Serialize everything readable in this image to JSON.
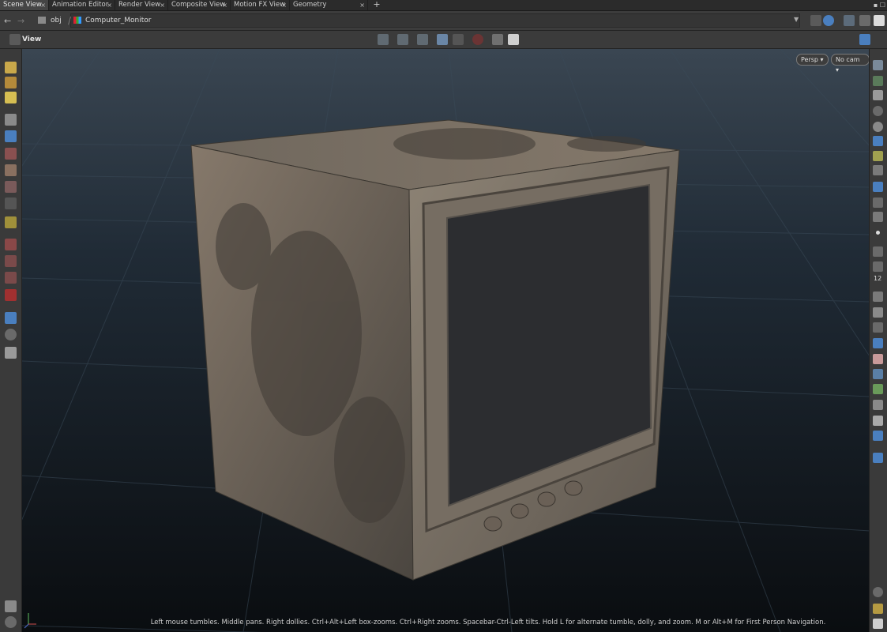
{
  "tabs": [
    {
      "label": "Scene View",
      "active": true
    },
    {
      "label": "Animation Editor",
      "active": false
    },
    {
      "label": "Render View",
      "active": false
    },
    {
      "label": "Composite View",
      "active": false
    },
    {
      "label": "Motion FX View",
      "active": false
    },
    {
      "label": "Geometry Spreadsheet",
      "active": false
    }
  ],
  "tab_close_glyph": "×",
  "add_tab_glyph": "+",
  "window_controls": "▪ ☐",
  "path": {
    "root": "obj",
    "node": "Computer_Monitor"
  },
  "viewer": {
    "label": "View"
  },
  "viewport": {
    "camera_mode": "Persp",
    "camera": "No cam"
  },
  "status_text": "Left mouse tumbles. Middle pans. Right dollies. Ctrl+Alt+Left box-zooms. Ctrl+Right zooms. Spacebar-Ctrl-Left tilts. Hold L for alternate tumble, dolly, and zoom.     M or Alt+M for First Person Navigation.",
  "right_toolbar_number": "12",
  "colors": {
    "tab_active": "#454545",
    "accent_blue": "#4a7fbf",
    "grid": "#2c3a47",
    "background": "#1e2a36",
    "model": "#7d7569",
    "screen": "#2c2d30"
  },
  "icons": {
    "left_toolbar": [
      "paint-icon",
      "pose-icon",
      "sculpt-icon",
      "select-icon",
      "lock-icon",
      "handle-icon",
      "view-icon",
      "camera-icon",
      "light-icon",
      "scale-icon",
      "rotate-icon",
      "magnet-icon",
      "snap-icon",
      "pivot-icon",
      "display-icon",
      "render-icon"
    ],
    "right_toolbar": [
      "display-options-icon",
      "wire-icon",
      "lock-icon",
      "xray-icon",
      "shade-icon",
      "light-icon",
      "bulb-icon",
      "camera-light-icon",
      "cam-icon",
      "pose-icon",
      "point-icon",
      "edge-icon",
      "brush-icon",
      "number-icon",
      "cut-icon",
      "paint-icon",
      "curve-icon",
      "knife-icon",
      "checker-icon",
      "plane-icon",
      "butterfly-icon",
      "joint-icon",
      "layer-icon",
      "image-icon",
      "info-icon",
      "grid-icon",
      "eye-icon"
    ]
  }
}
